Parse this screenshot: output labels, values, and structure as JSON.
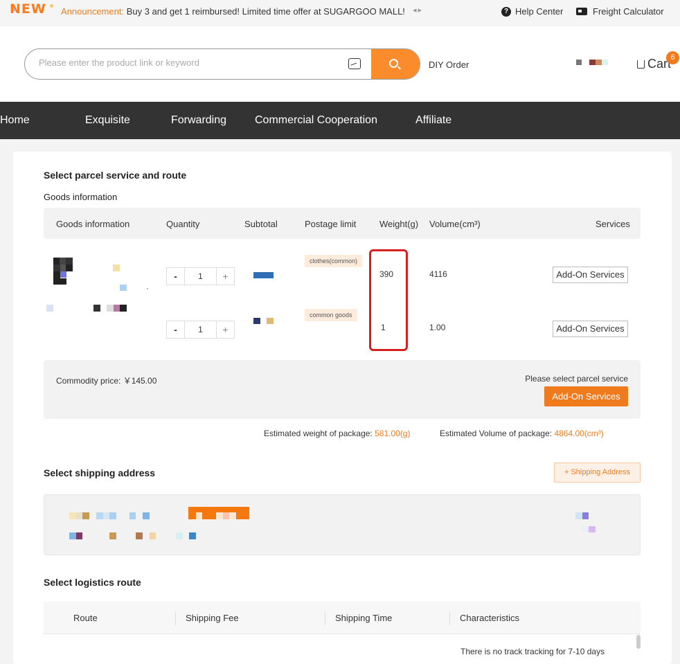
{
  "topbar": {
    "new_badge": "NEW",
    "announcement_label": "Announcement:",
    "announcement_text": "Buy 3 and get 1 reimbursed! Limited time offer at SUGARGOO MALL!",
    "arrows": "◂▸",
    "help_icon": "?",
    "help_center": "Help Center",
    "freight_calculator": "Freight Calculator"
  },
  "header": {
    "search_placeholder": "Please enter the product link or keyword",
    "diy_order": "DIY Order",
    "cart_label": "Cart",
    "cart_count": "6"
  },
  "nav": {
    "items": [
      "Home",
      "Exquisite",
      "Forwarding",
      "Commercial Cooperation",
      "Affiliate"
    ]
  },
  "parcel": {
    "title": "Select parcel service and route",
    "goods_subtitle": "Goods information",
    "columns": [
      "Goods information",
      "Quantity",
      "Subtotal",
      "Postage limit",
      "Weight(g)",
      "Volume(cm³)",
      "Services"
    ],
    "rows": [
      {
        "quantity": "1",
        "postage_limit": "clothes(common)",
        "weight": "390",
        "volume": "4116",
        "service_button": "Add-On Services"
      },
      {
        "quantity": "1",
        "postage_limit": "common goods",
        "weight": "1",
        "volume": "1.00",
        "service_button": "Add-On Services"
      }
    ],
    "stepper_minus": "-",
    "stepper_plus": "+",
    "commodity_label": "Commodity price:",
    "commodity_value": "￥145.00",
    "parcel_hint": "Please select parcel service",
    "addon_button": "Add-On Services",
    "est_weight_label": "Estimated weight of package:",
    "est_weight_value": "581.00(g)",
    "est_volume_label": "Estimated Volume of package:",
    "est_volume_value": "4864.00(cm³)"
  },
  "shipping": {
    "title": "Select shipping address",
    "add_button": "+ Shipping Address"
  },
  "logistics": {
    "title": "Select logistics route",
    "columns": [
      "Route",
      "Shipping Fee",
      "Shipping Time",
      "Characteristics"
    ],
    "first_row_characteristics": "There is no track tracking for 7-10 days"
  },
  "colors": {
    "accent": "#f07b1d",
    "nav_bg": "#333333",
    "highlight": "#d62020"
  }
}
